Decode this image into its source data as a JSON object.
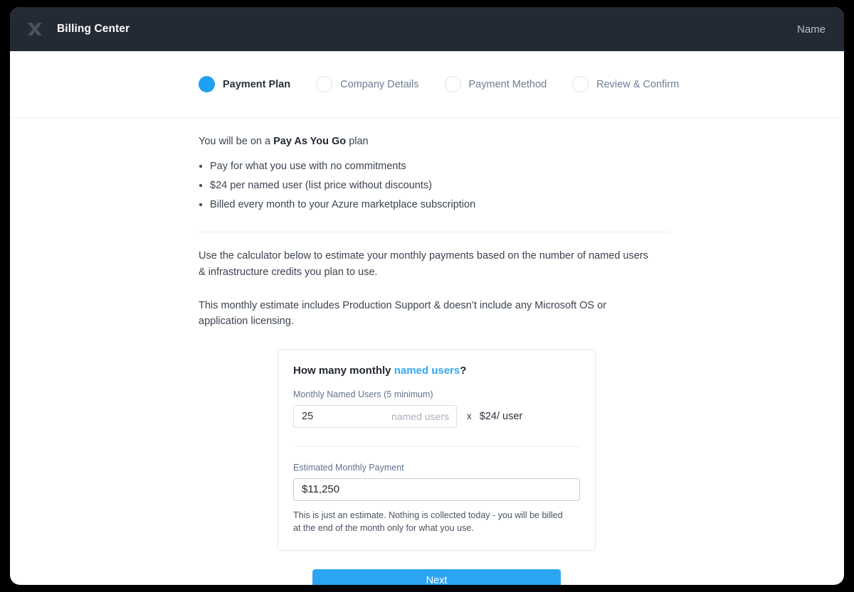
{
  "header": {
    "logo_icon": "x-logo-icon",
    "title": "Billing Center",
    "user_name": "Name"
  },
  "steps": [
    {
      "label": "Payment Plan",
      "state": "active"
    },
    {
      "label": "Company Details",
      "state": "inactive"
    },
    {
      "label": "Payment Method",
      "state": "inactive"
    },
    {
      "label": "Review & Confirm",
      "state": "inactive"
    }
  ],
  "main": {
    "lead_prefix": "You will be on a ",
    "lead_plan": "Pay As You Go",
    "lead_suffix": " plan",
    "bullets": [
      "Pay for what you use with no commitments",
      "$24 per named user (list price without discounts)",
      "Billed every month to your Azure marketplace subscription"
    ],
    "paragraph_1": "Use the calculator below to estimate your monthly payments based on the number of named users & infrastructure credits you plan to use.",
    "paragraph_2": "This monthly estimate includes Production Support & doesn’t include any Microsoft OS or application licensing."
  },
  "calculator": {
    "question_prefix": "How many monthly ",
    "question_link": "named users",
    "question_suffix": "?",
    "users_label": "Monthly Named Users (5 minimum)",
    "users_value": "25",
    "users_placeholder": "named users",
    "users_suffix": "named users",
    "multiply_symbol": "x",
    "rate": "$24/ user",
    "estimate_label": "Estimated Monthly Payment",
    "estimate_value": "$11,250",
    "estimate_placeholder": "$0",
    "fine_print": "This is just an estimate. Nothing is collected today - you will be billed at the end of the month only for what you use."
  },
  "actions": {
    "next_label": "Next"
  },
  "colors": {
    "accent_blue": "#20a0f3",
    "link_blue": "#35a7f2",
    "button_blue": "#2ba5f2",
    "header_dark": "#242a35",
    "label_muted": "#62738d"
  }
}
